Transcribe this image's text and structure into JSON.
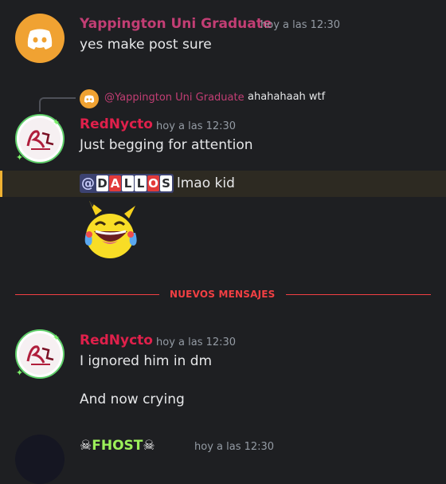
{
  "messages": [
    {
      "author": "Yappington Uni Graduate",
      "author_color": "#c23e74",
      "timestamp": "hoy a las 12:30",
      "avatar": "discord-logo-icon",
      "lines": [
        "yes make post sure"
      ]
    },
    {
      "author": "RedNycto",
      "author_color": "#e0204b",
      "timestamp": "hoy a las 12:30",
      "avatar": "rednycto-avatar",
      "reply": {
        "author": "@Yappington Uni Graduate",
        "text": "ahahahaah wtf"
      },
      "lines": [
        "Just begging for attention"
      ]
    },
    {
      "mention_prefix": "@",
      "mention_letters": [
        "D",
        "A",
        "L",
        "L",
        "O",
        "S"
      ],
      "text": "lmao kid",
      "emoji": "laughing-crying-pikachu-emoji"
    },
    {
      "author": "RedNycto",
      "author_color": "#e0204b",
      "timestamp": "hoy a las 12:30",
      "avatar": "rednycto-avatar",
      "lines": [
        "I ignored him in dm",
        "And now crying"
      ]
    },
    {
      "author_partial": "FHOST",
      "timestamp": "hoy a las 12:30"
    }
  ],
  "divider": {
    "label": "NUEVOS MENSAJES",
    "color": "#f23f43"
  },
  "colors": {
    "background": "#1e1f22",
    "mention_bg": "#2d2a22",
    "mention_bar": "#f0b232",
    "discord_orange": "#f0a232"
  }
}
